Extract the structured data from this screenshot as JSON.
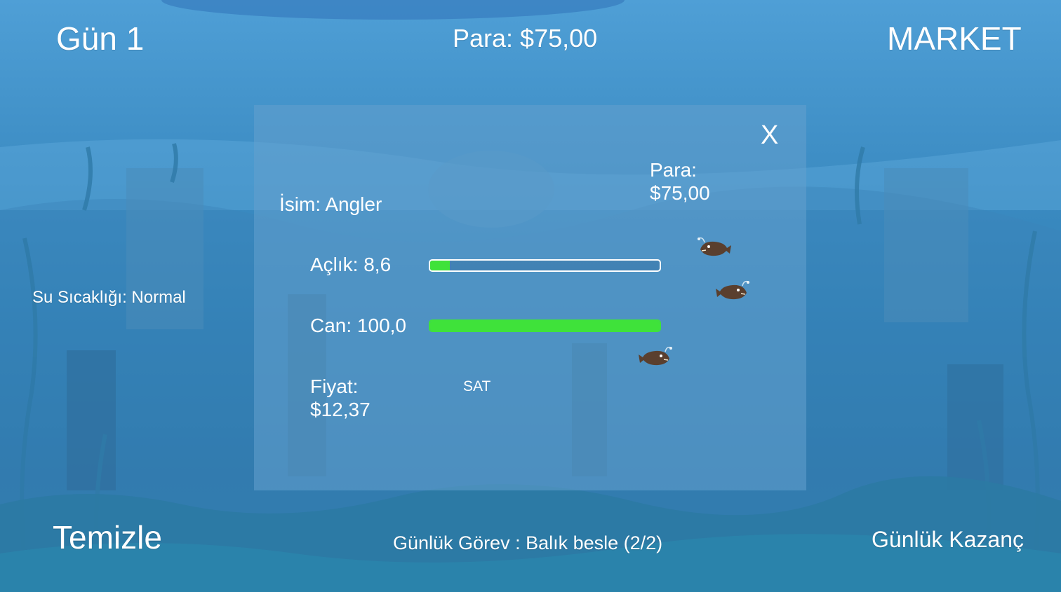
{
  "hud": {
    "day_label": "Gün 1",
    "money_label": "Para: $75,00",
    "market_label": "MARKET",
    "water_temp_label": "Su Sıcaklığı: Normal",
    "clean_label": "Temizle",
    "daily_task_label": "Günlük Görev : Balık besle (2/2)",
    "daily_earnings_label": "Günlük Kazanç"
  },
  "fish_panel": {
    "close_label": "X",
    "money_label": "Para:\n$75,00",
    "name_label": "İsim: Angler",
    "hunger_label": "Açlık: 8,6",
    "hunger_fraction": 0.086,
    "health_label": "Can: 100,0",
    "health_fraction": 1.0,
    "price_label": "Fiyat:\n$12,37",
    "sell_label": "SAT"
  },
  "colors": {
    "bar_fill": "#3fe23a",
    "panel_overlay": "rgba(100,160,205,0.55)",
    "water_top": "#4f9fd6",
    "water_bottom": "#2a74a6"
  },
  "icons": [
    "anglerfish-icon",
    "anglerfish-icon",
    "anglerfish-icon"
  ]
}
